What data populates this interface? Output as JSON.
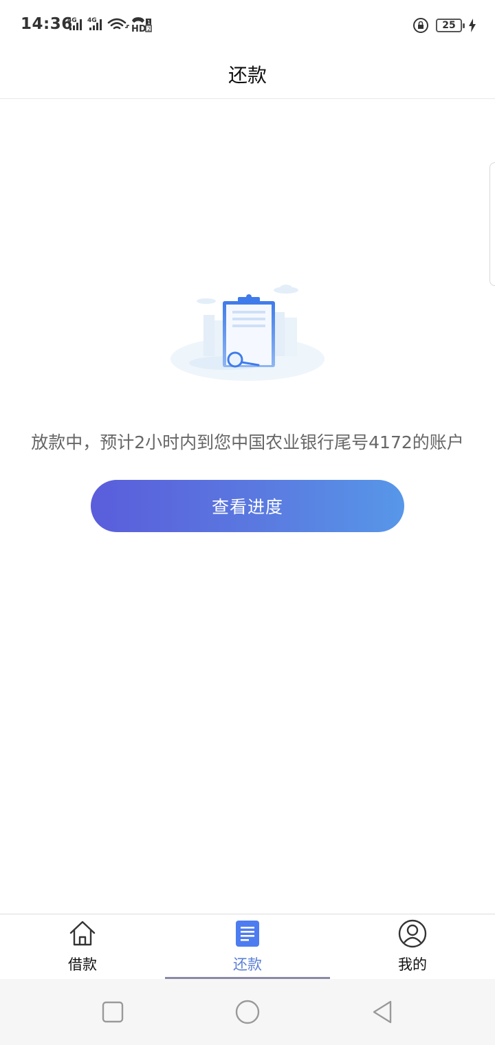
{
  "status_bar": {
    "time": "14:36",
    "network_1": "4G",
    "network_2": "4G",
    "hd_label": "HD",
    "battery_level": "25",
    "icons": [
      "signal-icon",
      "signal-icon",
      "wifi-icon",
      "hd-call-icon",
      "lock-rotation-icon",
      "battery-icon",
      "charging-icon"
    ]
  },
  "header": {
    "title": "还款"
  },
  "main": {
    "message": "放款中，预计2小时内到您中国农业银行尾号4172的账户",
    "button_label": "查看进度"
  },
  "tabs": [
    {
      "label": "借款",
      "icon": "home-icon",
      "active": false
    },
    {
      "label": "还款",
      "icon": "document-icon",
      "active": true
    },
    {
      "label": "我的",
      "icon": "user-icon",
      "active": false
    }
  ],
  "colors": {
    "accent": "#5b7fd6",
    "button_gradient_start": "#5a5ddb",
    "button_gradient_end": "#5797e8",
    "message_text": "#666666"
  }
}
